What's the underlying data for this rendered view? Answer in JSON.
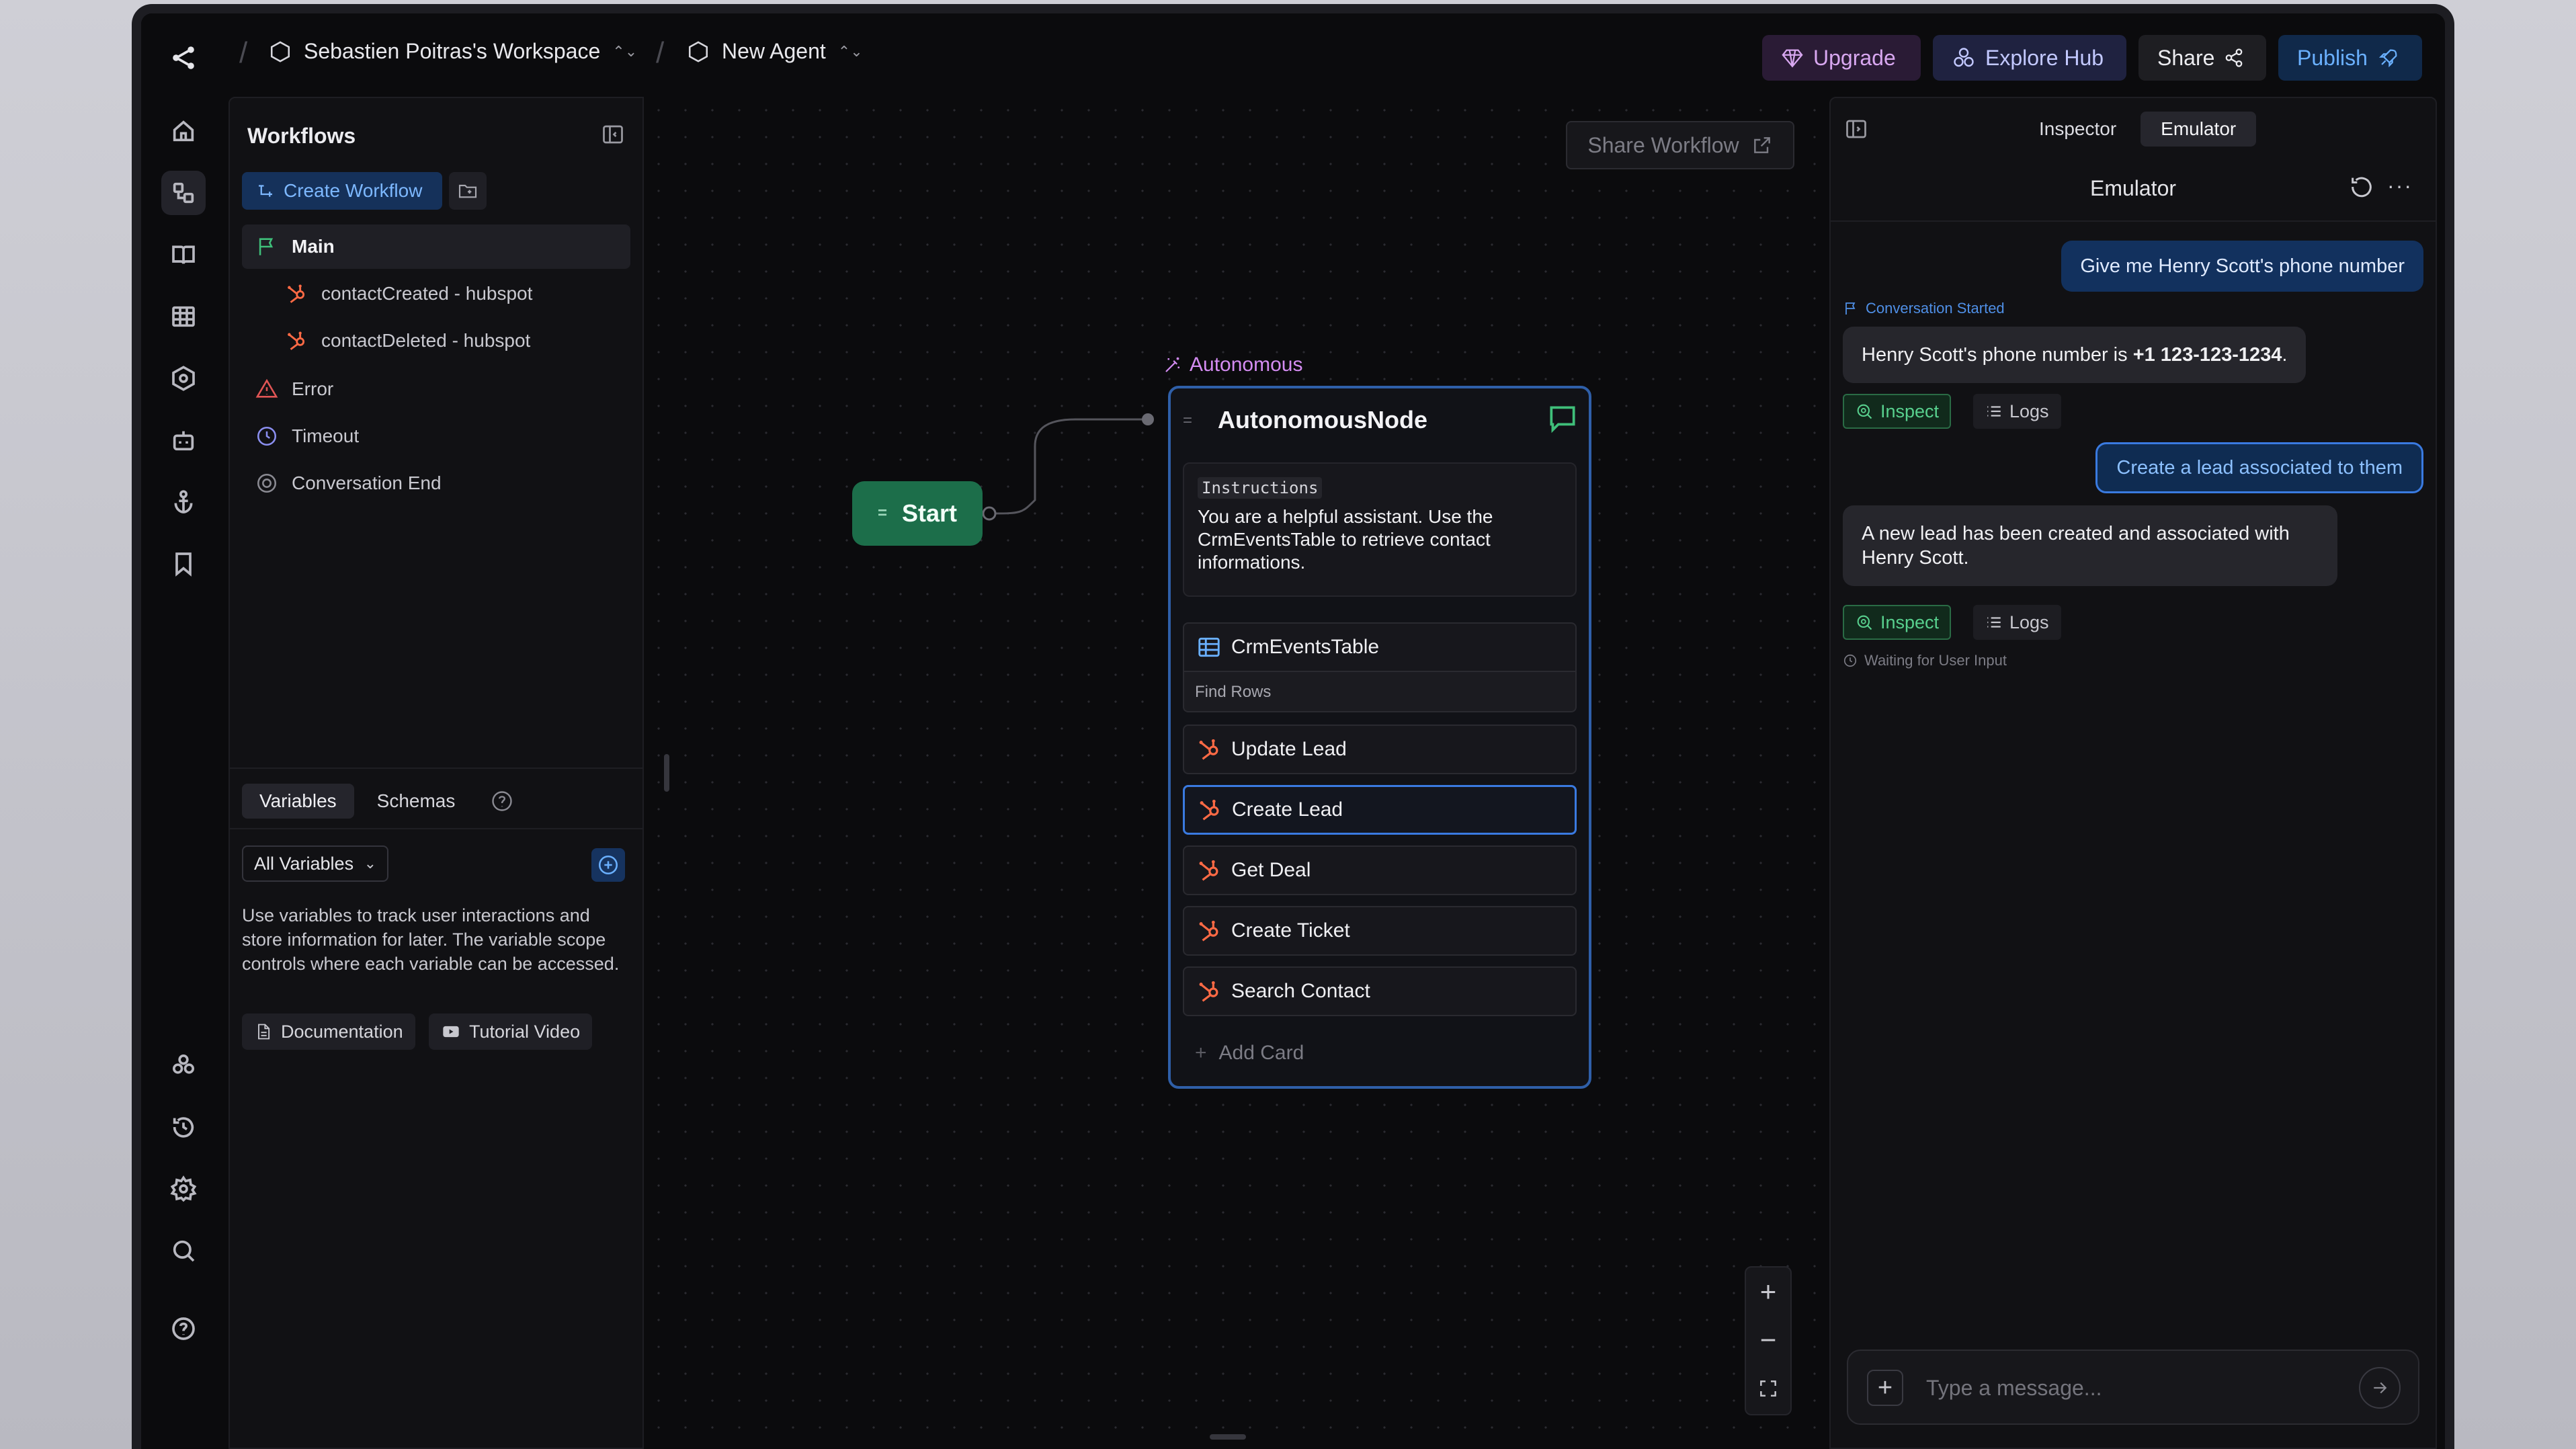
{
  "topbar": {
    "workspace": "Sebastien Poitras's Workspace",
    "agent": "New Agent",
    "upgrade": "Upgrade",
    "explore_hub": "Explore Hub",
    "share": "Share",
    "publish": "Publish"
  },
  "rail": {
    "icons": [
      "home-icon",
      "workflows-icon",
      "knowledge-book-icon",
      "tables-icon",
      "hexagon-icon",
      "bot-icon",
      "anchor-icon",
      "bookmark-icon",
      "integrations-icon",
      "history-icon",
      "settings-icon",
      "search-icon",
      "help-icon"
    ]
  },
  "workflows": {
    "title": "Workflows",
    "create_label": "Create Workflow",
    "items": [
      {
        "label": "Main",
        "icon": "flag-icon"
      },
      {
        "label": "contactCreated - hubspot",
        "icon": "hubspot-icon"
      },
      {
        "label": "contactDeleted - hubspot",
        "icon": "hubspot-icon"
      },
      {
        "label": "Error",
        "icon": "warning-icon"
      },
      {
        "label": "Timeout",
        "icon": "clock-icon"
      },
      {
        "label": "Conversation End",
        "icon": "end-icon"
      }
    ]
  },
  "variables": {
    "tabs": [
      "Variables",
      "Schemas"
    ],
    "filter": "All Variables",
    "description": "Use variables to track user interactions and store information for later. The variable scope controls where each variable can be accessed.",
    "doc_button": "Documentation",
    "video_button": "Tutorial Video"
  },
  "canvas": {
    "share_workflow": "Share Workflow",
    "start_label": "Start",
    "autonomous_label": "Autonomous",
    "node": {
      "title": "AutonomousNode",
      "instructions_label": "Instructions",
      "instructions_text": "You are a helpful assistant. Use the CrmEventsTable to retrieve contact informations.",
      "table_card": "CrmEventsTable",
      "table_card_sub": "Find Rows",
      "cards": [
        "Update Lead",
        "Create Lead",
        "Get Deal",
        "Create Ticket",
        "Search Contact"
      ],
      "selected_card": "Create Lead",
      "add_card": "Add Card"
    },
    "zoom": {
      "in": "+",
      "out": "−"
    }
  },
  "emulator": {
    "tabs": [
      "Inspector",
      "Emulator"
    ],
    "active_tab": "Emulator",
    "title": "Emulator",
    "messages": {
      "user1": "Give me Henry Scott's phone number",
      "conversation_started": "Conversation Started",
      "bot1_prefix": "Henry Scott's phone number is ",
      "bot1_phone": "+1 123-123-1234",
      "bot1_suffix": ".",
      "user2": "Create a lead associated to them",
      "bot2": "A new lead has been created and associated with Henry Scott."
    },
    "inspect_label": "Inspect",
    "logs_label": "Logs",
    "waiting": "Waiting for User Input",
    "composer_placeholder": "Type a message..."
  },
  "colors": {
    "accent_blue": "#3a7ae0",
    "start_green": "#1c6e4a",
    "autonomous_purple": "#d48cf2",
    "hubspot_orange": "#ff6a45",
    "inspect_green": "#58d08e"
  }
}
